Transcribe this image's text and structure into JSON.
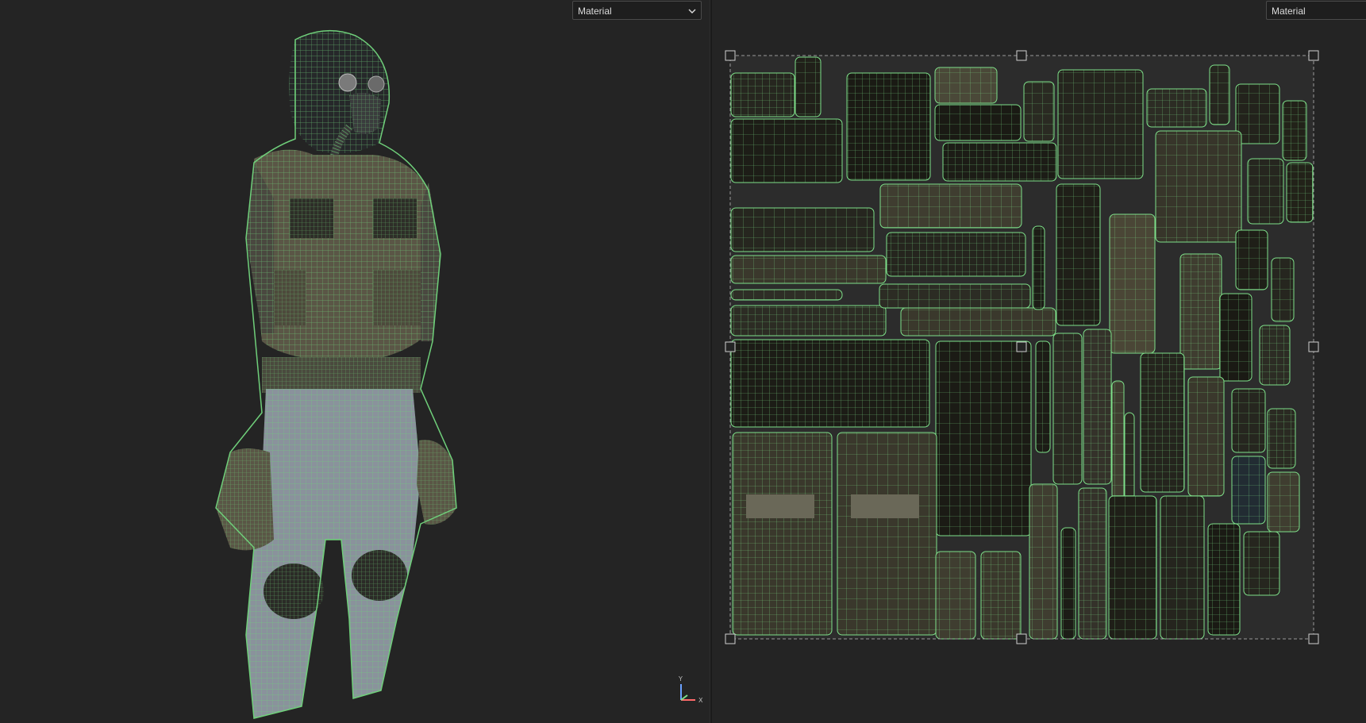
{
  "left_viewport": {
    "material_select": {
      "value": "Material"
    },
    "axis_gizmo": {
      "y_label": "Y",
      "x_label": "X"
    }
  },
  "uv_viewport": {
    "material_select": {
      "value": "Material"
    }
  },
  "colors": {
    "background": "#242424",
    "wireframe": "#6fcf7a",
    "uv_grid": "#7ee08a",
    "fabric_dark": "#2a2a22",
    "fabric_tan": "#5a5646",
    "pants": "#8a929c"
  }
}
